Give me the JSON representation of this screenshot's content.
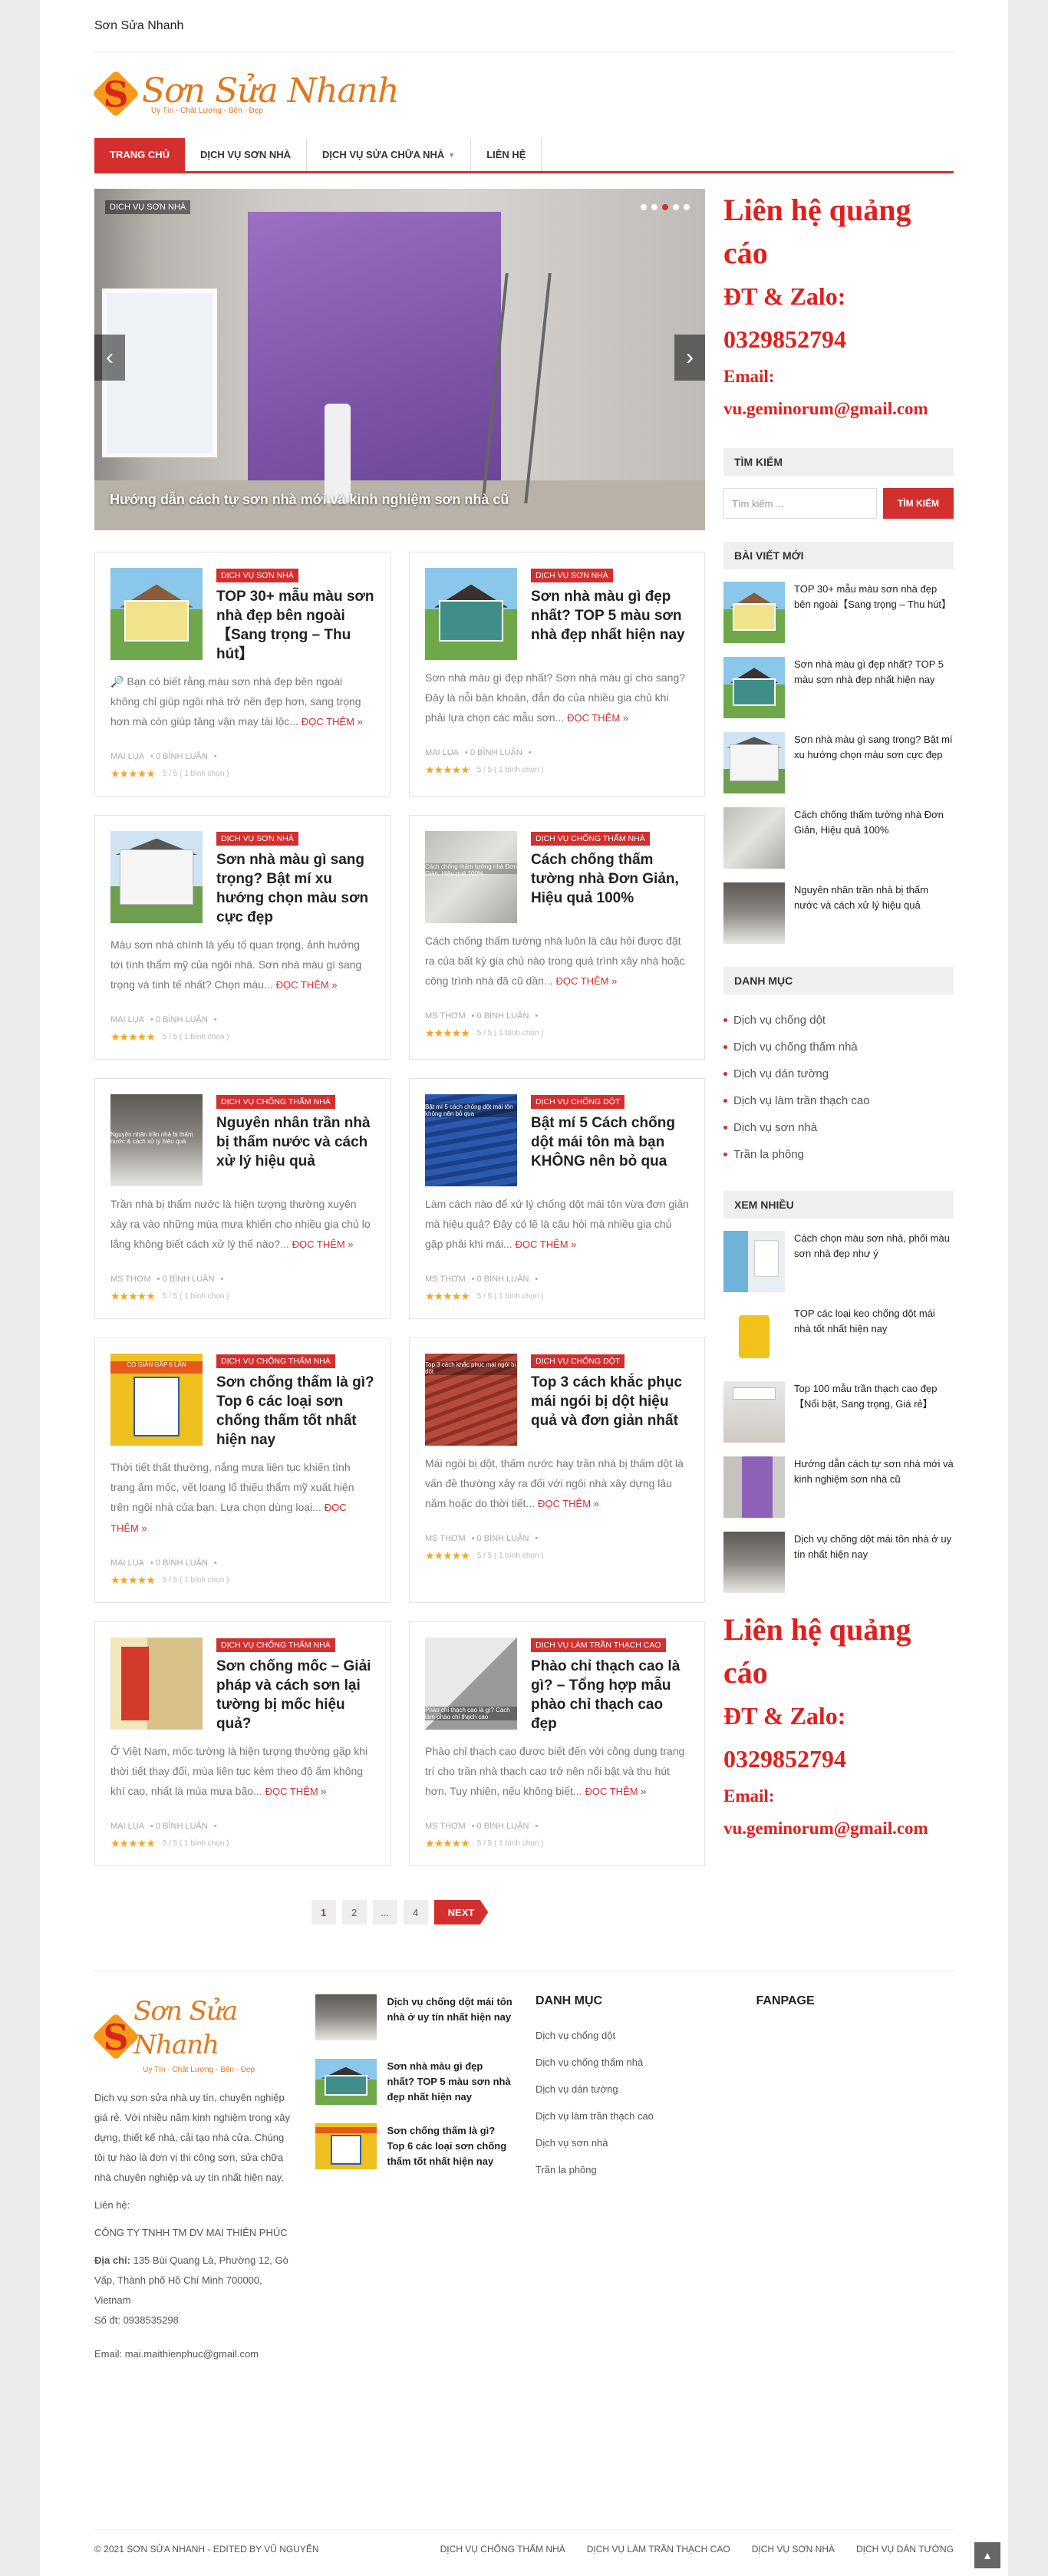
{
  "site": {
    "title": "Sơn Sửa Nhanh",
    "logo_main": "Sơn Sửa Nhanh",
    "logo_tagline": "Uy Tín - Chất Lượng - Bền - Đẹp"
  },
  "nav": [
    {
      "label": "TRANG CHỦ",
      "active": true
    },
    {
      "label": "DỊCH VỤ SƠN NHÀ"
    },
    {
      "label": "DỊCH VỤ SỬA CHỮA NHÀ",
      "dropdown": true
    },
    {
      "label": "LIÊN HỆ"
    }
  ],
  "slider": {
    "tag": "DỊCH VỤ SƠN NHÀ",
    "caption": "Hướng dẫn cách tự sơn nhà mới và kinh nghiệm sơn nhà cũ",
    "prev": "‹",
    "next": "›"
  },
  "posts": [
    {
      "cat": "DỊCH VỤ SƠN NHÀ",
      "title": "TOP 30+ mẫu màu sơn nhà đẹp bên ngoài【Sang trọng – Thu hút】",
      "excerpt": "🔎 Bạn có biết rằng màu sơn nhà đẹp bên ngoài không chỉ giúp ngôi nhà trở nên đẹp hơn, sang trọng hơn mà còn giúp tăng vận may tài lộc...",
      "author": "MAI LỤA",
      "comments": "0 BÌNH LUẬN",
      "rating": "5 / 5 ( 1 bình chọn )"
    },
    {
      "cat": "DỊCH VỤ SƠN NHÀ",
      "title": "Sơn nhà màu gì đẹp nhất? TOP 5 màu sơn nhà đẹp nhất hiện nay",
      "excerpt": "Sơn nhà màu gì đẹp nhất? Sơn nhà màu gì cho sang? Đây là nỗi băn khoăn, đắn đo của nhiều gia chủ khi phải lựa chọn các mẫu sơn...",
      "author": "MAI LỤA",
      "comments": "0 BÌNH LUẬN",
      "rating": "5 / 5 ( 1 bình chọn )"
    },
    {
      "cat": "DỊCH VỤ SƠN NHÀ",
      "title": "Sơn nhà màu gì sang trọng? Bật mí xu hướng chọn màu sơn cực đẹp",
      "excerpt": "Màu sơn nhà chính là yếu tố quan trọng, ảnh hưởng tới tính thẩm mỹ của ngôi nhà. Sơn nhà màu gì sang trọng và tinh tế nhất? Chọn màu...",
      "author": "MAI LỤA",
      "comments": "0 BÌNH LUẬN",
      "rating": "5 / 5 ( 1 bình chọn )"
    },
    {
      "cat": "DỊCH VỤ CHỐNG THẤM NHÀ",
      "title": "Cách chống thấm tường nhà Đơn Giản, Hiệu quả 100%",
      "excerpt": "Cách chống thấm tường nhà luôn là câu hỏi được đặt ra của bất kỳ gia chủ nào trong quá trình xây nhà hoặc công trình nhà đã cũ dần...",
      "author": "MS THƠM",
      "comments": "0 BÌNH LUẬN",
      "rating": "5 / 5 ( 1 bình chọn )"
    },
    {
      "cat": "DỊCH VỤ CHỐNG THẤM NHÀ",
      "title": "Nguyên nhân trần nhà bị thấm nước và cách xử lý hiệu quả",
      "excerpt": "Trần nhà bị thấm nước là hiện tượng thường xuyên xảy ra vào những mùa mưa khiến cho nhiều gia chủ lo lắng không biết cách xử lý thế nào?...",
      "author": "MS THƠM",
      "comments": "0 BÌNH LUẬN",
      "rating": "5 / 5 ( 1 bình chọn )"
    },
    {
      "cat": "DỊCH VỤ CHỐNG DỘT",
      "title": "Bật mí 5 Cách chống dột mái tôn mà bạn KHÔNG nên bỏ qua",
      "excerpt": "Làm cách nào để xử lý chống dột mái tôn vừa đơn giản mà hiệu quả? Đây có lẽ là câu hỏi mà nhiều gia chủ gặp phải khi mái...",
      "author": "MS THƠM",
      "comments": "0 BÌNH LUẬN",
      "rating": "5 / 5 ( 1 bình chọn )"
    },
    {
      "cat": "DỊCH VỤ CHỐNG THẤM NHÀ",
      "title": "Sơn chống thấm là gì? Top 6 các loại sơn chống thấm tốt nhất hiện nay",
      "excerpt": "Thời tiết thất thường, nắng mưa liên tục khiến tình trạng ẩm mốc, vết loang lổ thiếu thẩm mỹ xuất hiện trên ngôi nhà của bạn. Lựa chọn dùng loại...",
      "author": "MAI LỤA",
      "comments": "0 BÌNH LUẬN",
      "rating": "5 / 5 ( 1 bình chọn )"
    },
    {
      "cat": "DỊCH VỤ CHỐNG DỘT",
      "title": "Top 3 cách khắc phục mái ngói bị dột hiệu quả và đơn giản nhất",
      "excerpt": "Mái ngói bị dột, thấm nước hay trần nhà bị thấm dột là vấn đề thường xảy ra đối với ngôi nhà xây dựng lâu năm hoặc do thời tiết...",
      "author": "MS THƠM",
      "comments": "0 BÌNH LUẬN",
      "rating": "5 / 5 ( 1 bình chọn )"
    },
    {
      "cat": "DỊCH VỤ CHỐNG THẤM NHÀ",
      "title": "Sơn chống mốc – Giải pháp và cách sơn lại tường bị mốc hiệu quả?",
      "excerpt": "Ở Việt Nam, mốc tường là hiện tượng thường gặp khi thời tiết thay đổi, mùa liên tục kèm theo độ ẩm không khí cao, nhất là mùa mưa bão...",
      "author": "MAI LỤA",
      "comments": "0 BÌNH LUẬN",
      "rating": "5 / 5 ( 1 bình chọn )"
    },
    {
      "cat": "DỊCH VỤ LÀM TRẦN THẠCH CAO",
      "title": "Phào chỉ thạch cao là gì? – Tổng hợp mẫu phào chỉ thạch cao đẹp",
      "excerpt": "Phào chỉ thạch cao được biết đến với công dụng trang trí cho trần nhà thạch cao trở nên nổi bật và thu hút hơn. Tuy nhiên, nếu không biết...",
      "author": "MS THƠM",
      "comments": "0 BÌNH LUẬN",
      "rating": "5 / 5 ( 1 bình chọn )"
    }
  ],
  "read_more": "ĐỌC THÊM »",
  "pager": [
    "1",
    "2",
    "...",
    "4",
    "NEXT"
  ],
  "ad": {
    "line1": "Liên hệ quảng cáo",
    "line2": "ĐT & Zalo: 0329852794",
    "line3": "Email: vu.geminorum@gmail.com"
  },
  "sidebar": {
    "search_title": "TÌM KIẾM",
    "search_placeholder": "Tìm kiếm ...",
    "search_button": "TÌM KIẾM",
    "recent_title": "BÀI VIẾT MỚI",
    "recent": [
      "TOP 30+ mẫu màu sơn nhà đẹp bên ngoài【Sang trọng – Thu hút】",
      "Sơn nhà màu gì đẹp nhất? TOP 5 màu sơn nhà đẹp nhất hiện nay",
      "Sơn nhà màu gì sang trọng? Bật mí xu hướng chọn màu sơn cực đẹp",
      "Cách chống thấm tường nhà Đơn Giản, Hiệu quả 100%",
      "Nguyên nhân trần nhà bị thấm nước và cách xử lý hiệu quả"
    ],
    "cat_title": "DANH MỤC",
    "categories": [
      "Dịch vụ chống dột",
      "Dịch vụ chống thấm nhà",
      "Dịch vụ dán tường",
      "Dịch vụ làm trần thạch cao",
      "Dịch vụ sơn nhà",
      "Trần la phông"
    ],
    "popular_title": "XEM NHIỀU",
    "popular": [
      "Cách chọn màu sơn nhà, phối màu sơn nhà đẹp như ý",
      "TOP các loại keo chống dột mái nhà tốt nhất hiện nay",
      "Top 100 mẫu trần thạch cao đẹp【Nổi bật, Sang trọng, Giá rẻ】",
      "Hướng dẫn cách tự sơn nhà mới và kinh nghiệm sơn nhà cũ",
      "Dịch vụ chống dột mái tôn nhà ở uy tín nhất hiện nay"
    ]
  },
  "footer": {
    "about": "Dịch vụ sơn sửa nhà uy tín, chuyên nghiệp giá rẻ. Với nhiều năm kinh nghiệm trong xây dựng, thiết kế nhà, cải tạo nhà cửa. Chúng tôi tự hào là đơn vị thi công sơn, sửa chữa nhà chuyên nghiệp và uy tín nhất hiện nay.",
    "contact_label": "Liên hệ:",
    "company": "CÔNG TY TNHH TM DV MAI THIÊN PHÚC",
    "address_label": "Địa chỉ:",
    "address": "135 Bùi Quang Là, Phường 12, Gò Vấp, Thành phố Hồ Chí Minh 700000, Vietnam",
    "phone": "Số đt: 0938535298",
    "email": "Email: mai.maithienphuc@gmail.com",
    "posts": [
      "Dịch vụ chống dột mái tôn nhà ở uy tín nhất hiện nay",
      "Sơn nhà màu gì đẹp nhất? TOP 5 màu sơn nhà đẹp nhất hiện nay",
      "Sơn chống thấm là gì? Top 6 các loại sơn chống thấm tốt nhất hiện nay"
    ],
    "cat_title": "DANH MỤC",
    "categories": [
      "Dịch vụ chống dột",
      "Dịch vụ chống thấm nhà",
      "Dịch vụ dán tường",
      "Dịch vụ làm trần thạch cao",
      "Dịch vụ sơn nhà",
      "Trần la phông"
    ],
    "fanpage_title": "FANPAGE",
    "copyright": "© 2021 SƠN SỬA NHANH - EDITED BY VŨ NGUYỄN",
    "bottom_links": [
      "DỊCH VỤ CHỐNG THẤM NHÀ",
      "DỊCH VỤ LÀM TRẦN THẠCH CAO",
      "DỊCH VỤ SƠN NHÀ",
      "DỊCH VỤ DÁN TƯỜNG"
    ]
  },
  "thumb_labels": {
    "wall": "Cách chống thấm tường nhà Đơn Giản, Hiệu quả 100%",
    "ceil": "Nguyên nhân trần nhà bị thấm nước & cách xử lý hiệu quả",
    "roof": "Bật mí 5 cách chống dột mái tôn không nên bỏ qua",
    "tile": "Top 3 cách khắc phục mái ngói bị dột",
    "can": "CO GIÃN GẤP 6 LẦN",
    "cornice": "Phào chỉ thạch cao là gì? Cách làm phào chỉ thạch cao"
  },
  "colors": {
    "accent": "#d32f2f",
    "star": "#f5a623",
    "ad": "#e0201e",
    "logo_orange": "#e0781e"
  }
}
